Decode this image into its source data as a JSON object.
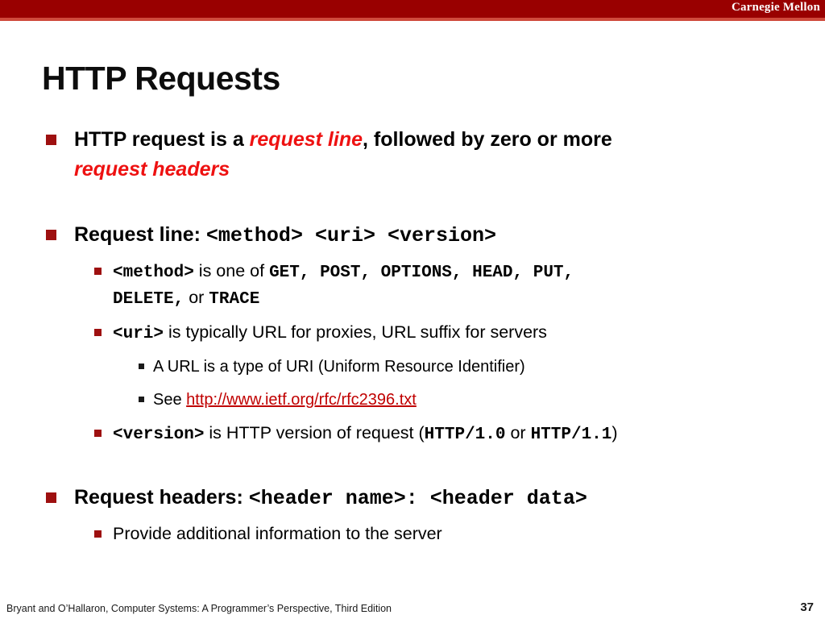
{
  "banner": {
    "institution": "Carnegie Mellon",
    "bg_color": "#990000",
    "accent_color": "#cf4a3c"
  },
  "slide": {
    "title": "HTTP Requests",
    "number": "37"
  },
  "colors": {
    "bullet_red": "#9e1010",
    "emphasis_red": "#ee1111",
    "link_red": "#c00000"
  },
  "content": {
    "bullet1": {
      "text_a": "HTTP request is a ",
      "em_1": "request line",
      "text_b": ", followed by zero or more",
      "em_2": "request headers"
    },
    "bullet2": {
      "label": "Request line: ",
      "code": "<method> <uri> <version>",
      "sub_method": {
        "code": "<method>",
        "text_a": " is one of ",
        "methods_line1": "GET, POST, OPTIONS, HEAD, PUT,",
        "methods_line2": "DELETE,",
        "text_b": " or ",
        "methods_line3": "TRACE"
      },
      "sub_uri": {
        "code": "<uri>",
        "text": " is typically URL for proxies, URL suffix for servers",
        "sub_a": "A URL is a type of URI (Uniform Resource Identifier)",
        "sub_b_prefix": "See ",
        "sub_b_link": "http://www.ietf.org/rfc/rfc2396.txt"
      },
      "sub_version": {
        "code": "<version>",
        "text_a": " is HTTP version of request (",
        "code_a": "HTTP/1.0",
        "text_b": " or ",
        "code_b": "HTTP/1.1",
        "text_c": ")"
      }
    },
    "bullet3": {
      "label": "Request headers: ",
      "code": "<header name>: <header data>",
      "sub": "Provide additional information to the server"
    }
  },
  "footer": {
    "citation": "Bryant and O’Hallaron, Computer Systems: A Programmer’s Perspective, Third Edition"
  }
}
